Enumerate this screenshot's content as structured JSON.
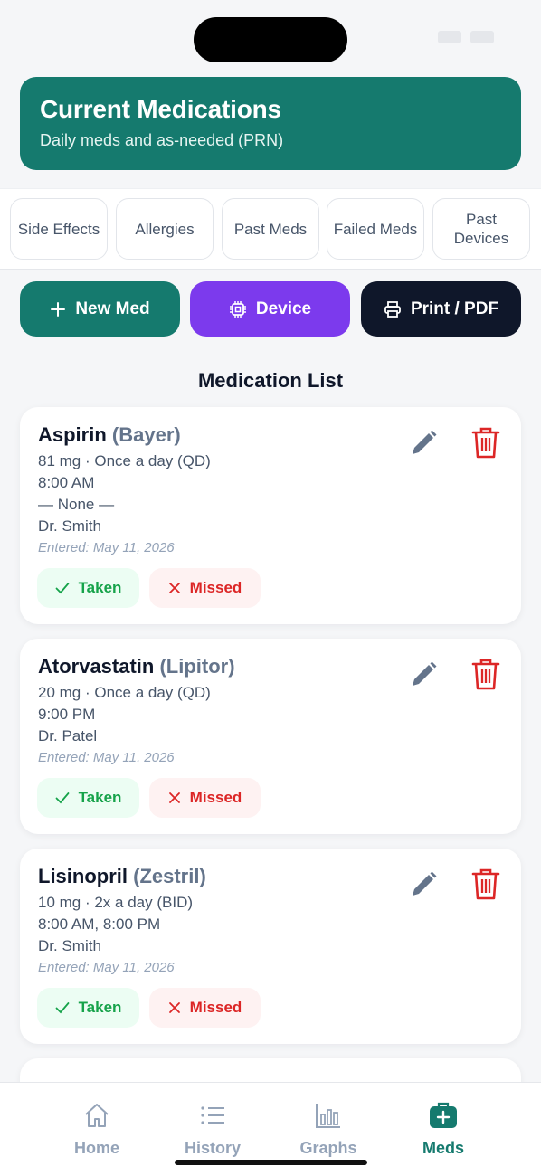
{
  "header": {
    "title": "Current Medications",
    "subtitle": "Daily meds and as-needed (PRN)"
  },
  "tabs": [
    {
      "label": "Side Effects"
    },
    {
      "label": "Allergies"
    },
    {
      "label": "Past Meds"
    },
    {
      "label": "Failed Meds"
    },
    {
      "label": "Past Devices"
    }
  ],
  "actions": {
    "new_med": "New Med",
    "device": "Device",
    "print": "Print / PDF"
  },
  "list_title": "Medication List",
  "medications": [
    {
      "name": "Aspirin",
      "brand": "(Bayer)",
      "dose": "81 mg · Once a day (QD)",
      "time": "8:00 AM",
      "extra": "— None —",
      "doctor": "Dr. Smith",
      "entered": "Entered: May 11, 2026"
    },
    {
      "name": "Atorvastatin",
      "brand": "(Lipitor)",
      "dose": "20 mg · Once a day (QD)",
      "time": "9:00 PM",
      "doctor": "Dr. Patel",
      "entered": "Entered: May 11, 2026"
    },
    {
      "name": "Lisinopril",
      "brand": "(Zestril)",
      "dose": "10 mg · 2x a day (BID)",
      "time": "8:00 AM, 8:00 PM",
      "doctor": "Dr. Smith",
      "entered": "Entered: May 11, 2026"
    }
  ],
  "pills": {
    "taken": "Taken",
    "missed": "Missed"
  },
  "nav": [
    {
      "label": "Home",
      "icon": "home-icon"
    },
    {
      "label": "History",
      "icon": "list-icon"
    },
    {
      "label": "Graphs",
      "icon": "bar-chart-icon"
    },
    {
      "label": "Meds",
      "icon": "medkit-icon",
      "active": true
    }
  ],
  "colors": {
    "primary": "#157a6e",
    "device": "#7c3aed",
    "print": "#0f172a",
    "taken": "#16a34a",
    "missed": "#dc2626"
  }
}
